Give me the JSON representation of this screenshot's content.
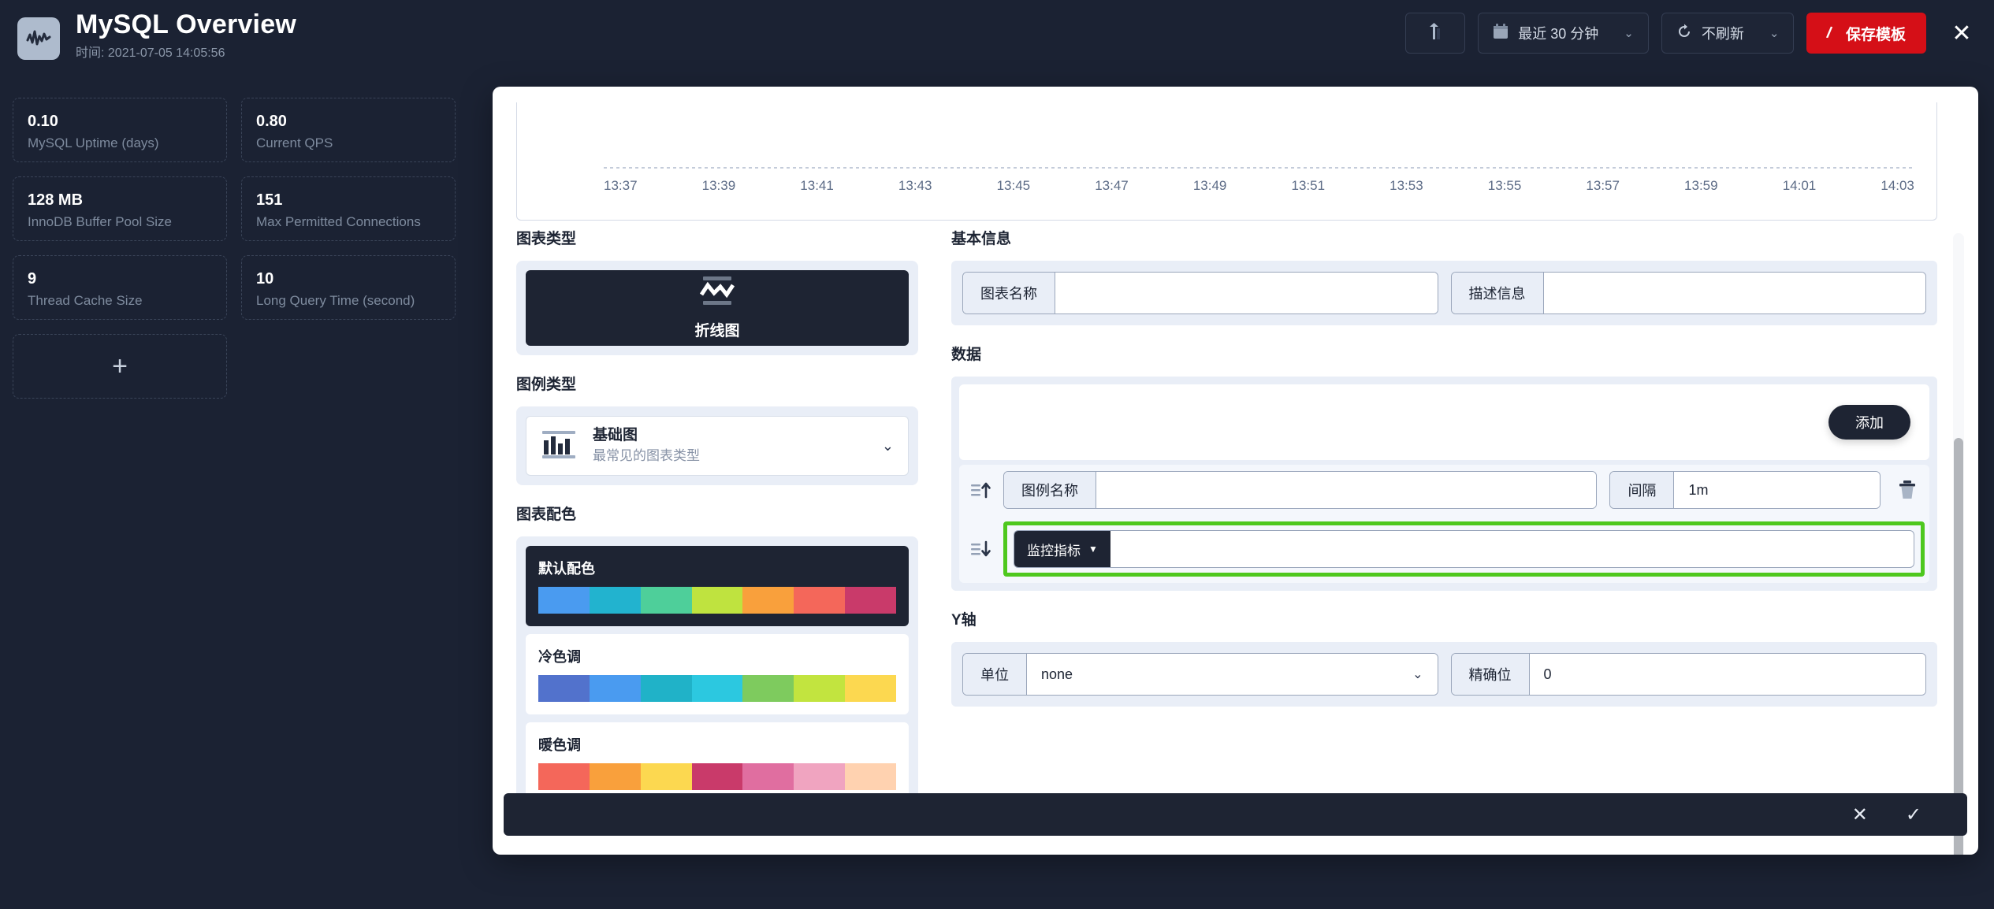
{
  "header": {
    "icon": "wave-chart-icon",
    "title": "MySQL Overview",
    "subtitle": "时间: 2021-07-05 14:05:56",
    "buttons": {
      "share": "share-icon",
      "time_range": "最近 30 分钟",
      "calendar_icon": "calendar-icon",
      "refresh": "不刷新",
      "refresh_icon": "refresh-icon",
      "save": "保存模板",
      "save_icon": "pencil-icon",
      "close": "✕"
    }
  },
  "sidebar": {
    "stats": [
      {
        "value": "0.10",
        "label": "MySQL Uptime (days)"
      },
      {
        "value": "0.80",
        "label": "Current QPS"
      },
      {
        "value": "128 MB",
        "label": "InnoDB Buffer Pool Size"
      },
      {
        "value": "151",
        "label": "Max Permitted Connections"
      },
      {
        "value": "9",
        "label": "Thread Cache Size"
      },
      {
        "value": "10",
        "label": "Long Query Time (second)"
      }
    ],
    "add_label": "+"
  },
  "preview": {
    "ticks": [
      "13:37",
      "13:39",
      "13:41",
      "13:43",
      "13:45",
      "13:47",
      "13:49",
      "13:51",
      "13:53",
      "13:55",
      "13:57",
      "13:59",
      "14:01",
      "14:03"
    ]
  },
  "modal": {
    "chart_type": {
      "title": "图表类型",
      "selected": "折线图"
    },
    "legend_type": {
      "title": "图例类型",
      "name": "基础图",
      "desc": "最常见的图表类型"
    },
    "palette": {
      "title": "图表配色",
      "items": [
        {
          "name": "默认配色",
          "selected": true,
          "colors": [
            "#4a9bf0",
            "#22b3cf",
            "#4ecf9a",
            "#bfe33f",
            "#f9a03c",
            "#f4675a",
            "#c93a6a"
          ]
        },
        {
          "name": "冷色调",
          "selected": false,
          "colors": [
            "#5272cc",
            "#4a9bf0",
            "#20b2c8",
            "#2cc8e0",
            "#7ecb5e",
            "#c2e43f",
            "#fcd850"
          ]
        },
        {
          "name": "暖色调",
          "selected": false,
          "colors": [
            "#f4675a",
            "#f9a03c",
            "#fcd850",
            "#c93a6a",
            "#e06ea0",
            "#f0a4c0",
            "#ffd2b0"
          ]
        }
      ]
    },
    "basic_info": {
      "title": "基本信息",
      "name_label": "图表名称",
      "name_value": "",
      "desc_label": "描述信息",
      "desc_value": ""
    },
    "data": {
      "title": "数据",
      "add_label": "添加",
      "rows": [
        {
          "handle": "drag-up-icon",
          "legend_label": "图例名称",
          "legend_value": "",
          "interval_label": "间隔",
          "interval_value": "1m",
          "delete_icon": "trash-icon",
          "highlighted": false
        },
        {
          "handle": "drag-down-icon",
          "metric_button": "监控指标",
          "metric_value": "",
          "highlighted": true,
          "highlight_color": "#4ec81e"
        }
      ]
    },
    "y_axis": {
      "title": "Y轴",
      "unit_label": "单位",
      "unit_value": "none",
      "precision_label": "精确位",
      "precision_value": "0"
    },
    "actions": {
      "cancel": "✕",
      "confirm": "✓"
    }
  }
}
